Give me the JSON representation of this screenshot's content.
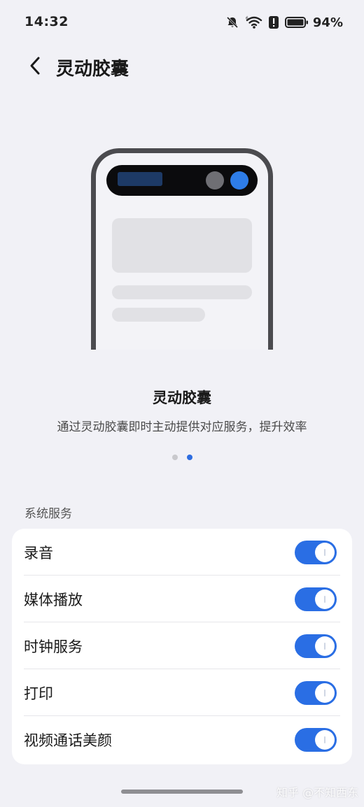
{
  "status_bar": {
    "time": "14:32",
    "icons": [
      "bell-off-icon",
      "wifi-icon",
      "alert-icon",
      "battery-icon"
    ],
    "battery_percent": "94%"
  },
  "header": {
    "back_icon": "chevron-left-icon",
    "title": "灵动胶囊"
  },
  "feature": {
    "title": "灵动胶囊",
    "description": "通过灵动胶囊即时主动提供对应服务，提升效率",
    "page_count": 2,
    "active_page": 2
  },
  "section": {
    "label": "系统服务",
    "items": [
      {
        "label": "录音",
        "enabled": true
      },
      {
        "label": "媒体播放",
        "enabled": true
      },
      {
        "label": "时钟服务",
        "enabled": true
      },
      {
        "label": "打印",
        "enabled": true
      },
      {
        "label": "视频通话美颜",
        "enabled": true
      }
    ]
  },
  "watermark": "知乎 @不知西东",
  "colors": {
    "accent": "#2a6ee4",
    "background": "#f1f1f6",
    "card": "#ffffff"
  }
}
